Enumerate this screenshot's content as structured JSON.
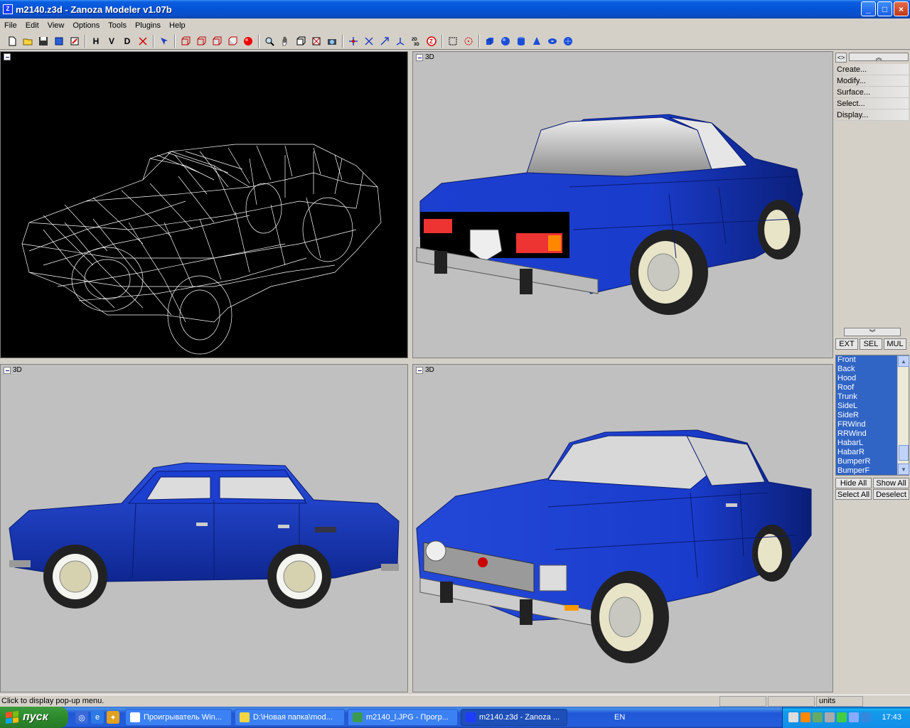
{
  "window": {
    "title": "m2140.z3d - Zanoza Modeler v1.07b",
    "controls": [
      "_",
      "□",
      "×"
    ]
  },
  "menu": [
    "File",
    "Edit",
    "View",
    "Options",
    "Tools",
    "Plugins",
    "Help"
  ],
  "toolbar": {
    "view_buttons": [
      "H",
      "V",
      "D"
    ]
  },
  "viewports": {
    "top_left": {
      "label": ""
    },
    "top_right": {
      "label": "3D"
    },
    "bottom_left": {
      "label": "3D"
    },
    "bottom_right": {
      "label": "3D"
    }
  },
  "right_panel": {
    "top_toggle": "<>",
    "collapse_up": "︽",
    "collapse_down": "︾",
    "menu_items": [
      "Create...",
      "Modify...",
      "Surface...",
      "Select...",
      "Display..."
    ],
    "tabs": [
      "EXT",
      "SEL",
      "MUL"
    ],
    "objects": [
      "Front",
      "Back",
      "Hood",
      "Roof",
      "Trunk",
      "SideL",
      "SideR",
      "FRWind",
      "RRWind",
      "HabarL",
      "HabarR",
      "BumperR",
      "BumperF"
    ],
    "buttons": [
      "Hide All",
      "Show All",
      "Select All",
      "Deselect"
    ]
  },
  "status": {
    "text": "Click to display pop-up menu.",
    "units": "units"
  },
  "taskbar": {
    "start": "пуск",
    "tasks": [
      "Проигрыватель Win...",
      "D:\\Новая папка\\mod...",
      "m2140_l.JPG - Прогр...",
      "m2140.z3d - Zanoza ..."
    ],
    "language": "EN",
    "clock": "17:43"
  },
  "colors": {
    "car_body": "#1a3fc8",
    "selection": "#3165c5",
    "xp_blue": "#245edb",
    "start_green": "#2d8a2d"
  }
}
